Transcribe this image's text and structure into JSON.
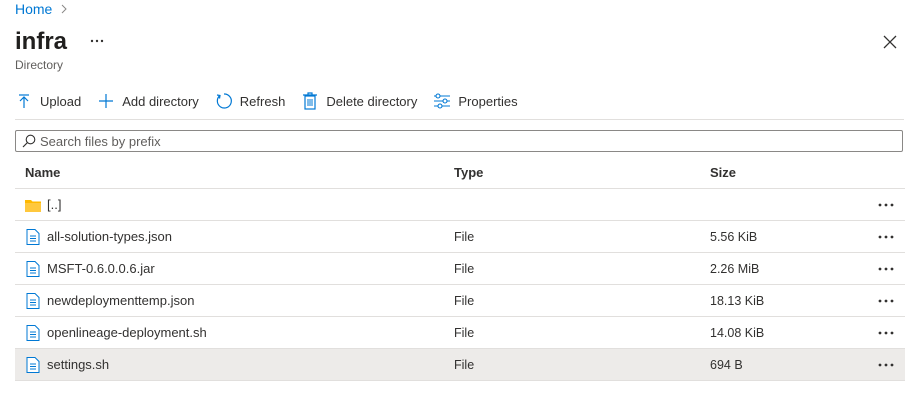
{
  "breadcrumb": {
    "home": "Home"
  },
  "header": {
    "title": "infra",
    "more": "···",
    "subtitle": "Directory"
  },
  "toolbar": {
    "upload": "Upload",
    "add_directory": "Add directory",
    "refresh": "Refresh",
    "delete_directory": "Delete directory",
    "properties": "Properties"
  },
  "search": {
    "placeholder": "Search files by prefix"
  },
  "table": {
    "headers": {
      "name": "Name",
      "type": "Type",
      "size": "Size"
    },
    "rows": [
      {
        "name": "[..]",
        "type": "",
        "size": "",
        "icon": "folder-icon"
      },
      {
        "name": "all-solution-types.json",
        "type": "File",
        "size": "5.56 KiB",
        "icon": "file-icon"
      },
      {
        "name": "MSFT-0.6.0.0.6.jar",
        "type": "File",
        "size": "2.26 MiB",
        "icon": "file-icon"
      },
      {
        "name": "newdeploymenttemp.json",
        "type": "File",
        "size": "18.13 KiB",
        "icon": "file-icon"
      },
      {
        "name": "openlineage-deployment.sh",
        "type": "File",
        "size": "14.08 KiB",
        "icon": "file-icon"
      },
      {
        "name": "settings.sh",
        "type": "File",
        "size": "694 B",
        "icon": "file-icon",
        "selected": true
      }
    ]
  },
  "colors": {
    "accent": "#0078d4",
    "folder": "#ffb900",
    "selected_row": "#edebe9"
  }
}
